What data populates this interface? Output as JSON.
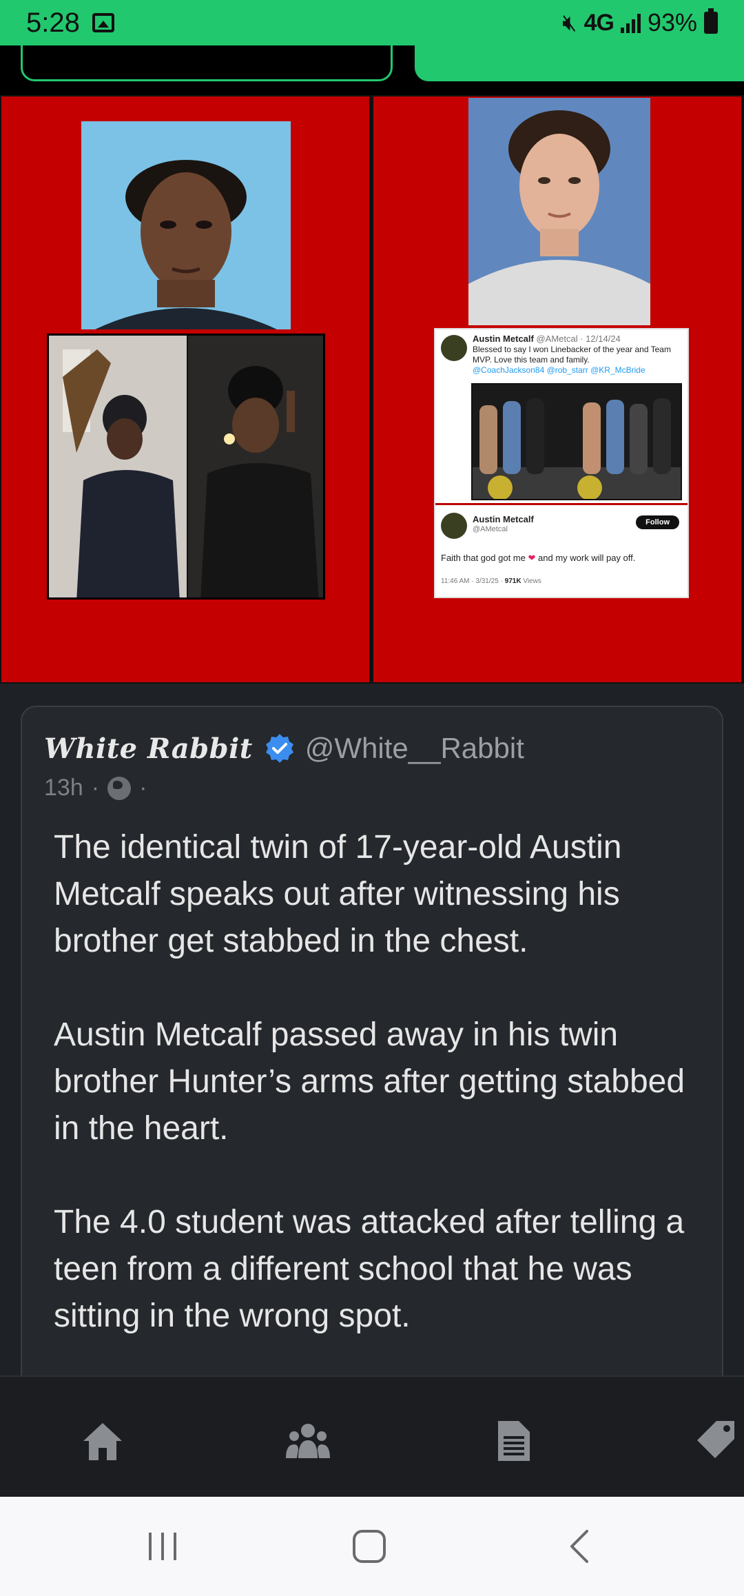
{
  "status_bar": {
    "time": "5:28",
    "network": "4G",
    "battery": "93%"
  },
  "images": {
    "right_tweet": {
      "name": "Austin Metcalf",
      "handle_date": "@AMetcal · 12/14/24",
      "text": "Blessed to say I won Linebacker of the year and Team MVP. Love this team and family.",
      "mentions": "@CoachJackson84 @rob_starr @KR_McBride",
      "name2": "Austin Metcalf",
      "handle2": "@AMetcal",
      "follow_label": "Follow",
      "text2_a": "Faith that god got me",
      "text2_b": "and my work will pay off.",
      "meta_time": "11:46 AM · 3/31/25 ·",
      "meta_views": "971K",
      "meta_views_label": "Views"
    }
  },
  "post": {
    "author": "White Rabbit",
    "handle": "@White__Rabbit",
    "time": "13h",
    "dot": "·",
    "paragraphs": [
      "The identical twin of 17-year-old Austin Metcalf speaks out after witnessing his brother get stabbed in the chest.",
      "Austin Metcalf passed away in his twin brother Hunter’s arms after getting stabbed in the heart.",
      "The 4.0 student was attacked after telling a teen from a different school that he was sitting in the wrong spot."
    ]
  },
  "bottom_nav": {
    "items": [
      "home-icon",
      "groups-icon",
      "document-icon",
      "tag-icon"
    ]
  },
  "colors": {
    "accent": "#22c86e",
    "verified": "#3b8ef0",
    "panel_red": "#c40000",
    "card_bg": "#25282c"
  }
}
